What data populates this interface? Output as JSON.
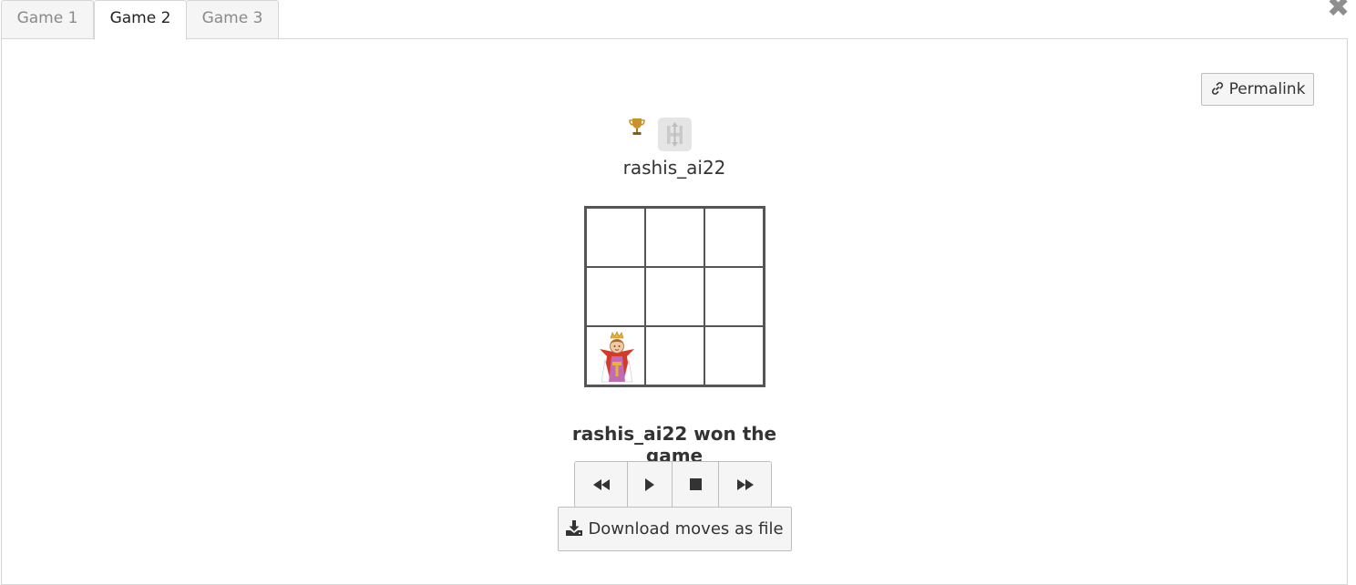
{
  "tabs": [
    {
      "label": "Game 1",
      "active": false
    },
    {
      "label": "Game 2",
      "active": true
    },
    {
      "label": "Game 3",
      "active": false
    }
  ],
  "close_icon": "close-icon",
  "permalink": {
    "label": "Permalink",
    "icon": "link-icon"
  },
  "player": {
    "name": "rashis_ai22",
    "icons": [
      "trophy-icon",
      "h-badge-icon"
    ]
  },
  "board": {
    "size": "3x3",
    "cells": [
      [
        "",
        "",
        ""
      ],
      [
        "",
        "",
        ""
      ],
      [
        "queen",
        "",
        ""
      ]
    ]
  },
  "result_text": "rashis_ai22 won the game",
  "controls": [
    "rewind-icon",
    "play-icon",
    "stop-icon",
    "fast-forward-icon"
  ],
  "download": {
    "label": "Download moves as file",
    "icon": "download-icon"
  },
  "colors": {
    "grid": "#555555",
    "button_bg": "#f5f5f5",
    "border": "#d6d6d6"
  }
}
